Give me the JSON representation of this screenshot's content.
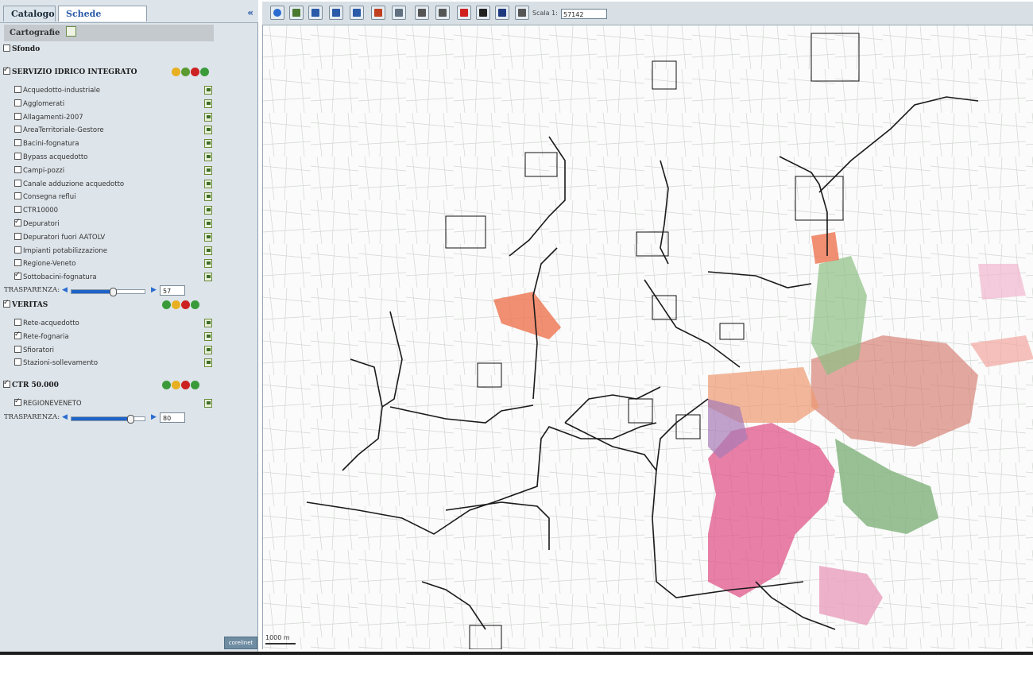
{
  "tabs": {
    "catalogo": "Catalogo",
    "schede": "Schede Intervento",
    "collapse": "«"
  },
  "sidebar": {
    "title": "Cartografie",
    "sfondo": {
      "label": "Sfondo",
      "checked": false
    },
    "groups": [
      {
        "label": "SERVIZIO IDRICO INTEGRATO",
        "checked": true,
        "layers": [
          {
            "label": "Acquedotto-industriale",
            "checked": false
          },
          {
            "label": "Agglomerati",
            "checked": false
          },
          {
            "label": "Allagamenti-2007",
            "checked": false
          },
          {
            "label": "AreaTerritoriale-Gestore",
            "checked": false
          },
          {
            "label": "Bacini-fognatura",
            "checked": false
          },
          {
            "label": "Bypass acquedotto",
            "checked": false
          },
          {
            "label": "Campi-pozzi",
            "checked": false
          },
          {
            "label": "Canale adduzione acquedotto",
            "checked": false
          },
          {
            "label": "Consegna reflui",
            "checked": false
          },
          {
            "label": "CTR10000",
            "checked": false
          },
          {
            "label": "Depuratori",
            "checked": true
          },
          {
            "label": "Depuratori fuori AATOLV",
            "checked": false
          },
          {
            "label": "Impianti potabilizzazione",
            "checked": false
          },
          {
            "label": "Regione-Veneto",
            "checked": false
          },
          {
            "label": "Sottobacini-fognatura",
            "checked": true
          }
        ],
        "transparency": {
          "label": "TRASPARENZA:",
          "value": "57",
          "level": 0.57
        }
      },
      {
        "label": "VERITAS",
        "checked": true,
        "layers": [
          {
            "label": "Rete-acquedotto",
            "checked": false
          },
          {
            "label": "Rete-fognaria",
            "checked": true
          },
          {
            "label": "Sfioratori",
            "checked": false
          },
          {
            "label": "Stazioni-sollevamento",
            "checked": false
          }
        ]
      },
      {
        "label": "CTR 50.000",
        "checked": true,
        "layers": [
          {
            "label": "REGIONEVENETO",
            "checked": true
          }
        ],
        "transparency": {
          "label": "TRASPARENZA:",
          "value": "80",
          "level": 0.8
        }
      }
    ],
    "logo": "corelinet"
  },
  "toolbar": {
    "tools": [
      "globe-icon",
      "pan-hand-icon",
      "zoom-box-icon",
      "zoom-in-icon",
      "zoom-out-icon",
      "print-icon",
      "export-icon",
      "select-box-icon",
      "clear-selection-icon",
      "delete-icon",
      "info-icon",
      "binoculars-icon",
      "printer-icon"
    ],
    "scale_label": "Scala 1:",
    "scale_value": "57142"
  },
  "map": {
    "scalebar": "1000 m"
  },
  "colors": {
    "network": "#1a1a1a",
    "sewer_orange": "#e0653a",
    "green_area": "#7fb27a",
    "pink_area": "#e0558a"
  }
}
